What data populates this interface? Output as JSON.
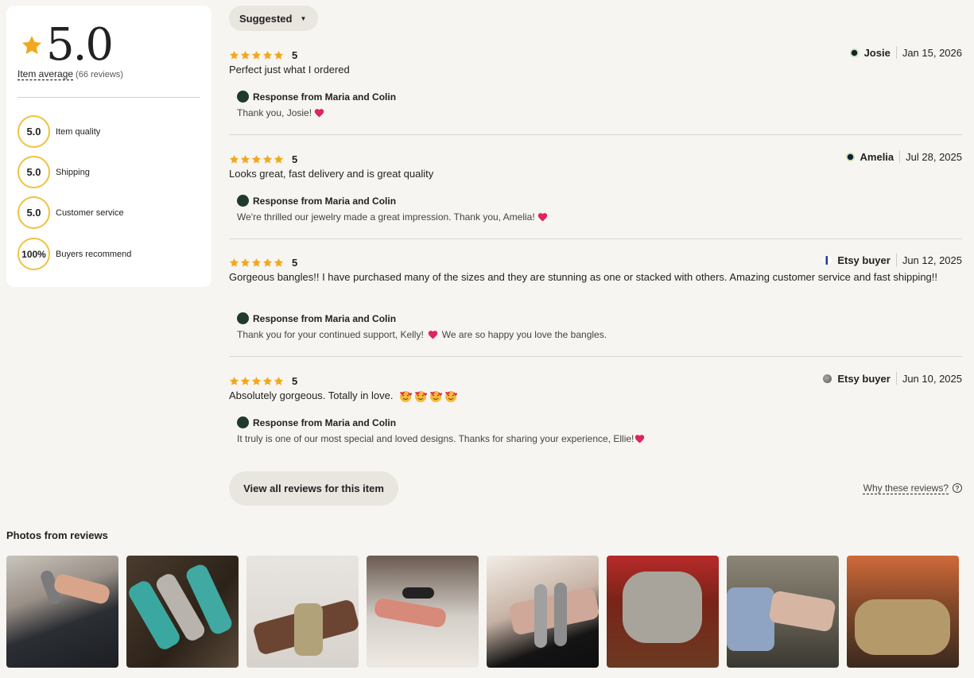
{
  "summary": {
    "average": "5.0",
    "average_link": "Item average",
    "review_count": "(66 reviews)",
    "metrics": [
      {
        "value": "5.0",
        "label": "Item quality"
      },
      {
        "value": "5.0",
        "label": "Shipping"
      },
      {
        "value": "5.0",
        "label": "Customer service"
      },
      {
        "value": "100%",
        "label": "Buyers recommend"
      }
    ]
  },
  "sort": {
    "label": "Suggested"
  },
  "reviews": [
    {
      "rating": "5",
      "reviewer": "Josie",
      "date": "Jan 15, 2026",
      "text": "Perfect just what I ordered",
      "response_title": "Response from Maria and Colin",
      "response_text": "Thank you, Josie!",
      "response_text_after": ""
    },
    {
      "rating": "5",
      "reviewer": "Amelia",
      "date": "Jul 28, 2025",
      "text": "Looks great, fast delivery and is great quality",
      "response_title": "Response from Maria and Colin",
      "response_text": "We're thrilled our jewelry made a great impression. Thank you, Amelia!",
      "response_text_after": ""
    },
    {
      "rating": "5",
      "reviewer": "Etsy buyer",
      "date": "Jun 12, 2025",
      "text": "Gorgeous bangles!! I have purchased many of the sizes and they are stunning as one or stacked with others. Amazing customer service and fast shipping!!",
      "response_title": "Response from Maria and Colin",
      "response_text": "Thank you for your continued support, Kelly!",
      "response_text_after": "We are so happy you love the bangles."
    },
    {
      "rating": "5",
      "reviewer": "Etsy buyer",
      "date": "Jun 10, 2025",
      "text": "Absolutely gorgeous. Totally in love.",
      "response_title": "Response from Maria and Colin",
      "response_text": "It truly is one of our most special and loved designs. Thanks for sharing your experience, Ellie!",
      "response_text_after": ""
    }
  ],
  "actions": {
    "view_all": "View all reviews for this item",
    "why": "Why these reviews?"
  },
  "photos": {
    "title": "Photos from reviews",
    "items": [
      {
        "icon": "review-photo"
      },
      {
        "icon": "review-photo"
      },
      {
        "icon": "review-photo"
      },
      {
        "icon": "review-photo"
      },
      {
        "icon": "review-photo"
      },
      {
        "icon": "review-photo"
      },
      {
        "icon": "review-photo"
      },
      {
        "icon": "review-photo"
      }
    ]
  },
  "colors": {
    "star": "#f1a81f",
    "circle_border": "#f1c141",
    "heart": "#e0245e",
    "shop_logo": "#1e3b2e"
  }
}
